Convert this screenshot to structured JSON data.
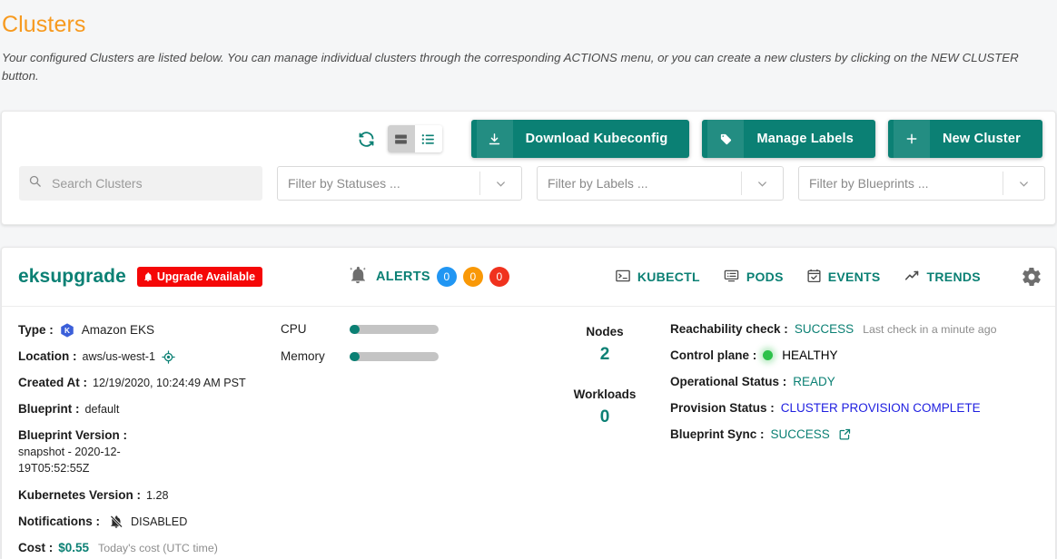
{
  "header": {
    "title": "Clusters",
    "description": "Your configured Clusters are listed below. You can manage individual clusters through the corresponding ACTIONS menu, or you can create a new clusters by clicking on the NEW CLUSTER button."
  },
  "toolbar": {
    "refresh_icon": "refresh-icon",
    "view_card_icon": "card-view-icon",
    "view_list_icon": "list-view-icon",
    "buttons": [
      {
        "label": "Download Kubeconfig",
        "icon": "download-icon"
      },
      {
        "label": "Manage Labels",
        "icon": "label-tag-icon"
      },
      {
        "label": "New Cluster",
        "icon": "plus-icon"
      }
    ]
  },
  "filters": {
    "search_placeholder": "Search Clusters",
    "search_value": "",
    "search_icon": "search-icon",
    "status_placeholder": "Filter by Statuses ...",
    "labels_placeholder": "Filter by Labels ...",
    "blueprints_placeholder": "Filter by Blueprints ..."
  },
  "cluster": {
    "name": "eksupgrade",
    "upgrade_badge": "Upgrade Available",
    "alerts": {
      "label": "ALERTS",
      "info_count": "0",
      "warning_count": "0",
      "critical_count": "0",
      "info_color": "#2196f3",
      "warning_color": "#f99806",
      "critical_color": "#f0321e"
    },
    "nav": [
      {
        "label": "KUBECTL",
        "icon": "terminal-icon"
      },
      {
        "label": "PODS",
        "icon": "pods-icon"
      },
      {
        "label": "EVENTS",
        "icon": "events-calendar-icon"
      },
      {
        "label": "TRENDS",
        "icon": "trends-icon"
      }
    ],
    "settings_icon": "gear-icon",
    "details": {
      "type_label": "Type :",
      "type_value": "Amazon EKS",
      "type_icon": "eks-hexagon-icon",
      "location_label": "Location :",
      "location_value": "aws/us-west-1",
      "location_icon": "location-target-icon",
      "created_label": "Created At :",
      "created_value": "12/19/2020, 10:24:49 AM PST",
      "blueprint_label": "Blueprint :",
      "blueprint_value": "default",
      "blueprint_version_label": "Blueprint Version :",
      "blueprint_version_value": "snapshot - 2020-12-19T05:52:55Z",
      "k8s_label": "Kubernetes Version :",
      "k8s_value": "1.28",
      "notifications_label": "Notifications :",
      "notifications_value": "DISABLED",
      "notifications_icon": "bell-off-icon",
      "cost_label": "Cost :",
      "cost_value": "$0.55",
      "cost_note": "Today's cost (UTC time)"
    },
    "metrics": {
      "cpu_label": "CPU",
      "memory_label": "Memory",
      "cpu_percent": 4,
      "memory_percent": 4
    },
    "counts": {
      "nodes_label": "Nodes",
      "nodes_value": "2",
      "workloads_label": "Workloads",
      "workloads_value": "0"
    },
    "status": {
      "reachability_label": "Reachability check :",
      "reachability_value": "SUCCESS",
      "reachability_note": "Last check in a minute ago",
      "control_plane_label": "Control plane :",
      "control_plane_value": "HEALTHY",
      "operational_label": "Operational Status :",
      "operational_value": "READY",
      "provision_label": "Provision Status :",
      "provision_value": "CLUSTER PROVISION COMPLETE",
      "blueprint_sync_label": "Blueprint Sync :",
      "blueprint_sync_value": "SUCCESS",
      "blueprint_sync_icon": "external-link-icon"
    }
  }
}
